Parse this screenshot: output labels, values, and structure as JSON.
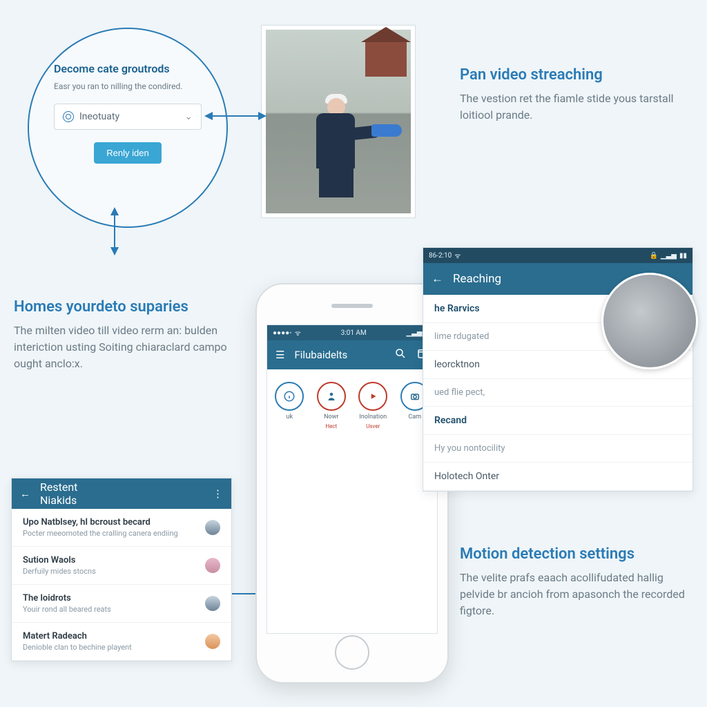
{
  "circle_card": {
    "title": "Decome cate groutrods",
    "subtitle": "Easr you ran to nilling the condired.",
    "select_label": "Ineotuaty",
    "button_label": "Renly iden"
  },
  "top_right": {
    "title": "Pan video streaching",
    "body": "The vestion ret the fiamle stide yous tarstall loitiool prande."
  },
  "mid_left": {
    "title": "Homes yourdeto suparies",
    "body": "The milten video till video rerm an: bulden interiction usting Soiting chiaraclard campo ought anclo:x."
  },
  "bot_right": {
    "title": "Motion detection settings",
    "body": "The velite prafs eaach acollifudated hallig pelvide br ancioh from apasonch the recorded figtore."
  },
  "phone": {
    "status_time": "3:01 AM",
    "app_title": "Filubaidelts",
    "actions": [
      {
        "label": "uk",
        "sub": ""
      },
      {
        "label": "Nowr",
        "sub": "Hect"
      },
      {
        "label": "Inolnation",
        "sub": "Usver"
      },
      {
        "label": "Cam",
        "sub": ""
      }
    ]
  },
  "screen_card": {
    "status_time": "86-2:10",
    "app_title": "Reaching",
    "rows": [
      {
        "text": "he Rarvics",
        "cls": "head"
      },
      {
        "text": "lime rdugated",
        "cls": "small"
      },
      {
        "text": "leorcktnon",
        "cls": ""
      },
      {
        "text": "ued flie pect,",
        "cls": "small"
      },
      {
        "text": "Recand",
        "cls": "head"
      },
      {
        "text": "Hy you nontocility",
        "cls": "small"
      },
      {
        "text": "Holotech Onter",
        "cls": ""
      }
    ]
  },
  "list_card": {
    "title": "Restent Niakids",
    "items": [
      {
        "title": "Upo Natblsey, hI bcroust becard",
        "sub": "Pocter meeomoted the cralling canera endiing"
      },
      {
        "title": "Sution Waols",
        "sub": "Derfuily mides stocns"
      },
      {
        "title": "The loidrots",
        "sub": "Youir rond all beared reats"
      },
      {
        "title": "Matert Radeach",
        "sub": "Denioble clan to bechine playent"
      }
    ]
  }
}
